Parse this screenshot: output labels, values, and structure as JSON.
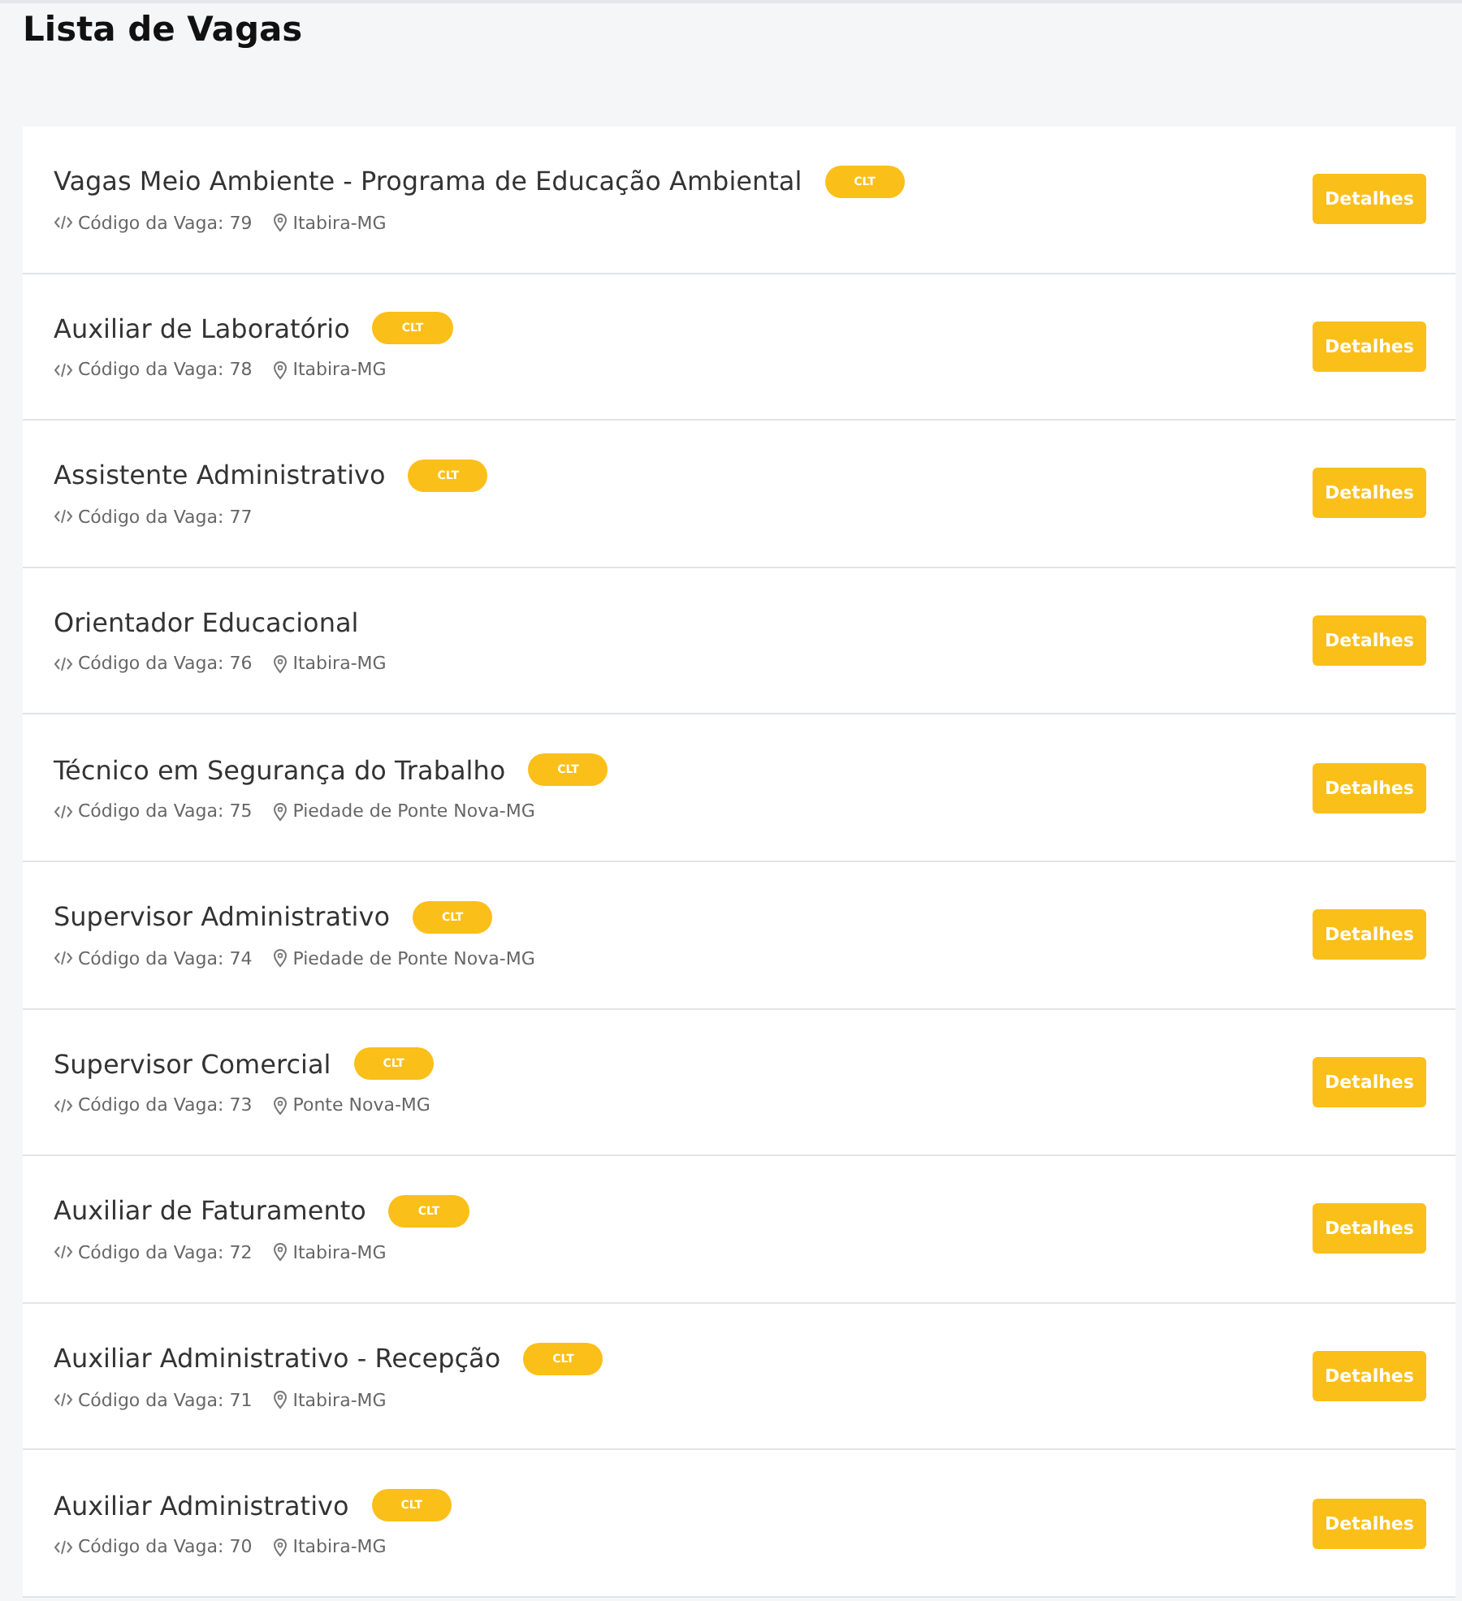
{
  "page_title": "Lista de Vagas",
  "jobs": [
    {
      "title": "Vagas Meio Ambiente - Programa de Educação Ambiental",
      "badge": "CLT",
      "code": "Código da Vaga: 79",
      "location": "Itabira-MG",
      "button": "Detalhes"
    },
    {
      "title": "Auxiliar de Laboratório",
      "badge": "CLT",
      "code": "Código da Vaga: 78",
      "location": "Itabira-MG",
      "button": "Detalhes"
    },
    {
      "title": "Assistente Administrativo",
      "badge": "CLT",
      "code": "Código da Vaga: 77",
      "button": "Detalhes"
    },
    {
      "title": "Orientador Educacional",
      "code": "Código da Vaga: 76",
      "location": "Itabira-MG",
      "button": "Detalhes"
    },
    {
      "title": "Técnico em Segurança do Trabalho",
      "badge": "CLT",
      "code": "Código da Vaga: 75",
      "location": "Piedade de Ponte Nova-MG",
      "button": "Detalhes"
    },
    {
      "title": "Supervisor Administrativo",
      "badge": "CLT",
      "code": "Código da Vaga: 74",
      "location": "Piedade de Ponte Nova-MG",
      "button": "Detalhes"
    },
    {
      "title": "Supervisor Comercial",
      "badge": "CLT",
      "code": "Código da Vaga: 73",
      "location": "Ponte Nova-MG",
      "button": "Detalhes"
    },
    {
      "title": "Auxiliar de Faturamento",
      "badge": "CLT",
      "code": "Código da Vaga: 72",
      "location": "Itabira-MG",
      "button": "Detalhes"
    },
    {
      "title": "Auxiliar Administrativo - Recepção",
      "badge": "CLT",
      "code": "Código da Vaga: 71",
      "location": "Itabira-MG",
      "button": "Detalhes"
    },
    {
      "title": "Auxiliar Administrativo",
      "badge": "CLT",
      "code": "Código da Vaga: 70",
      "location": "Itabira-MG",
      "button": "Detalhes"
    }
  ]
}
